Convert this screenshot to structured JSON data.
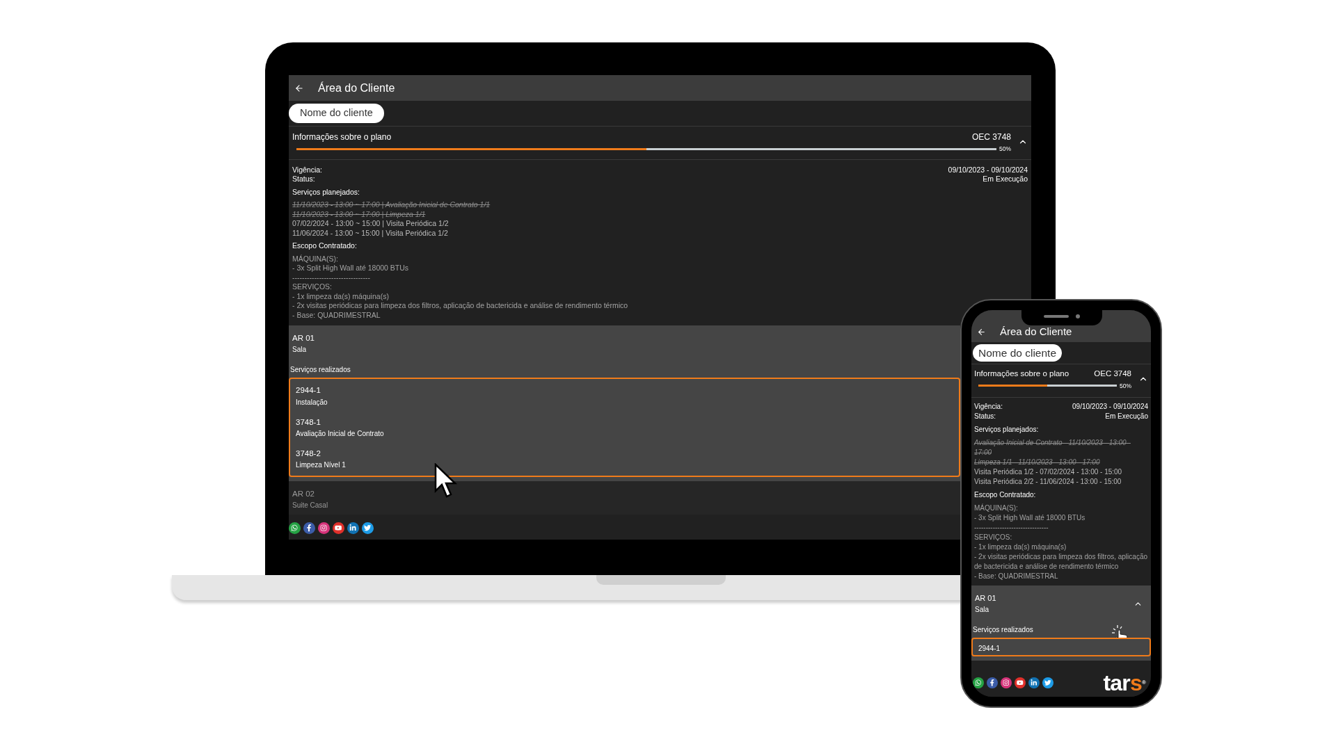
{
  "laptop": {
    "header": {
      "title": "Área do Cliente"
    },
    "client_name": "Nome do cliente",
    "plan": {
      "title": "Informações sobre o plano",
      "code": "OEC 3748",
      "level": 0.5,
      "percent": "50%",
      "expanded": true
    },
    "fields": [
      {
        "label": "Vigência:",
        "value": "09/10/2023 - 09/10/2024"
      },
      {
        "label": "Status:",
        "value": "Em Execução"
      }
    ],
    "planned_title": "Serviços planejados:",
    "planned": [
      {
        "text": "11/10/2023 - 13:00 ~ 17:00 | Avaliação Inicial de Contrato 1/1",
        "done": true
      },
      {
        "text": "11/10/2023 - 13:00 ~ 17:00 | Limpeza 1/1",
        "done": true
      },
      {
        "text": "07/02/2024 - 13:00 ~ 15:00 | Visita Periódica 1/2",
        "done": false
      },
      {
        "text": "11/06/2024 - 13:00 ~ 15:00 | Visita Periódica 1/2",
        "done": false
      }
    ],
    "scope_title": "Escopo Contratado:",
    "scope": [
      "MÁQUINA(S):",
      "- 3x Split High Wall até 18000 BTUs",
      "--------------------------------",
      "SERVIÇOS:",
      "- 1x limpeza da(s) máquina(s)",
      "- 2x visitas periódicas para limpeza dos filtros, aplicação de bactericida e análise de rendimento térmico",
      "- Base: QUADRIMESTRAL"
    ],
    "units": [
      {
        "name": "AR 01",
        "room": "Sala",
        "expanded": true,
        "services_title": "Serviços realizados",
        "services": [
          {
            "code": "2944-1",
            "name": "Instalação"
          },
          {
            "code": "3748-1",
            "name": "Avaliação Inicial de Contrato"
          },
          {
            "code": "3748-2",
            "name": "Limpeza Nível 1"
          }
        ]
      },
      {
        "name": "AR 02",
        "room": "Suite Casal",
        "expanded": false
      }
    ],
    "social": [
      {
        "kind": "whatsapp"
      },
      {
        "kind": "facebook"
      },
      {
        "kind": "instagram"
      },
      {
        "kind": "youtube"
      },
      {
        "kind": "linkedin"
      },
      {
        "kind": "twitter"
      }
    ]
  },
  "phone": {
    "header": {
      "title": "Área do Cliente"
    },
    "client_name": "Nome do cliente",
    "plan": {
      "title": "Informações sobre o plano",
      "code": "OEC 3748",
      "level": 0.5,
      "percent": "50%",
      "expanded": true
    },
    "fields": [
      {
        "label": "Vigência:",
        "value": "09/10/2023 - 09/10/2024"
      },
      {
        "label": "Status:",
        "value": "Em Execução"
      }
    ],
    "planned_title": "Serviços planejados:",
    "planned": [
      {
        "text": "Avaliação Inicial de Contrato - 11/10/2023 - 13:00 - 17:00",
        "done": true
      },
      {
        "text": "Limpeza 1/1 - 11/10/2023 - 13:00 - 17:00",
        "done": true
      },
      {
        "text": "Visita Periódica 1/2 - 07/02/2024 - 13:00 - 15:00",
        "done": false
      },
      {
        "text": "Visita Periódica 2/2 - 11/06/2024 - 13:00 - 15:00",
        "done": false
      }
    ],
    "scope_title": "Escopo Contratado:",
    "scope": [
      "MÁQUINA(S):",
      "- 3x Split High Wall até 18000 BTUs",
      "--------------------------------",
      "SERVIÇOS:",
      "- 1x limpeza da(s) máquina(s)",
      "- 2x visitas periódicas para limpeza dos filtros, aplicação de bactericida e análise de rendimento térmico",
      "- Base: QUADRIMESTRAL"
    ],
    "units": [
      {
        "name": "AR 01",
        "room": "Sala",
        "expanded": true,
        "chevron": true,
        "services_title": "Serviços realizados",
        "services": [
          {
            "code": "2944-1"
          }
        ]
      }
    ],
    "social": [
      {
        "kind": "whatsapp"
      },
      {
        "kind": "facebook"
      },
      {
        "kind": "instagram"
      },
      {
        "kind": "youtube"
      },
      {
        "kind": "linkedin"
      },
      {
        "kind": "twitter"
      }
    ],
    "logo": [
      {
        "text": "tar",
        "kind": "plain"
      },
      {
        "text": "s",
        "kind": "accent"
      },
      {
        "text": "®",
        "kind": "mark"
      }
    ]
  }
}
